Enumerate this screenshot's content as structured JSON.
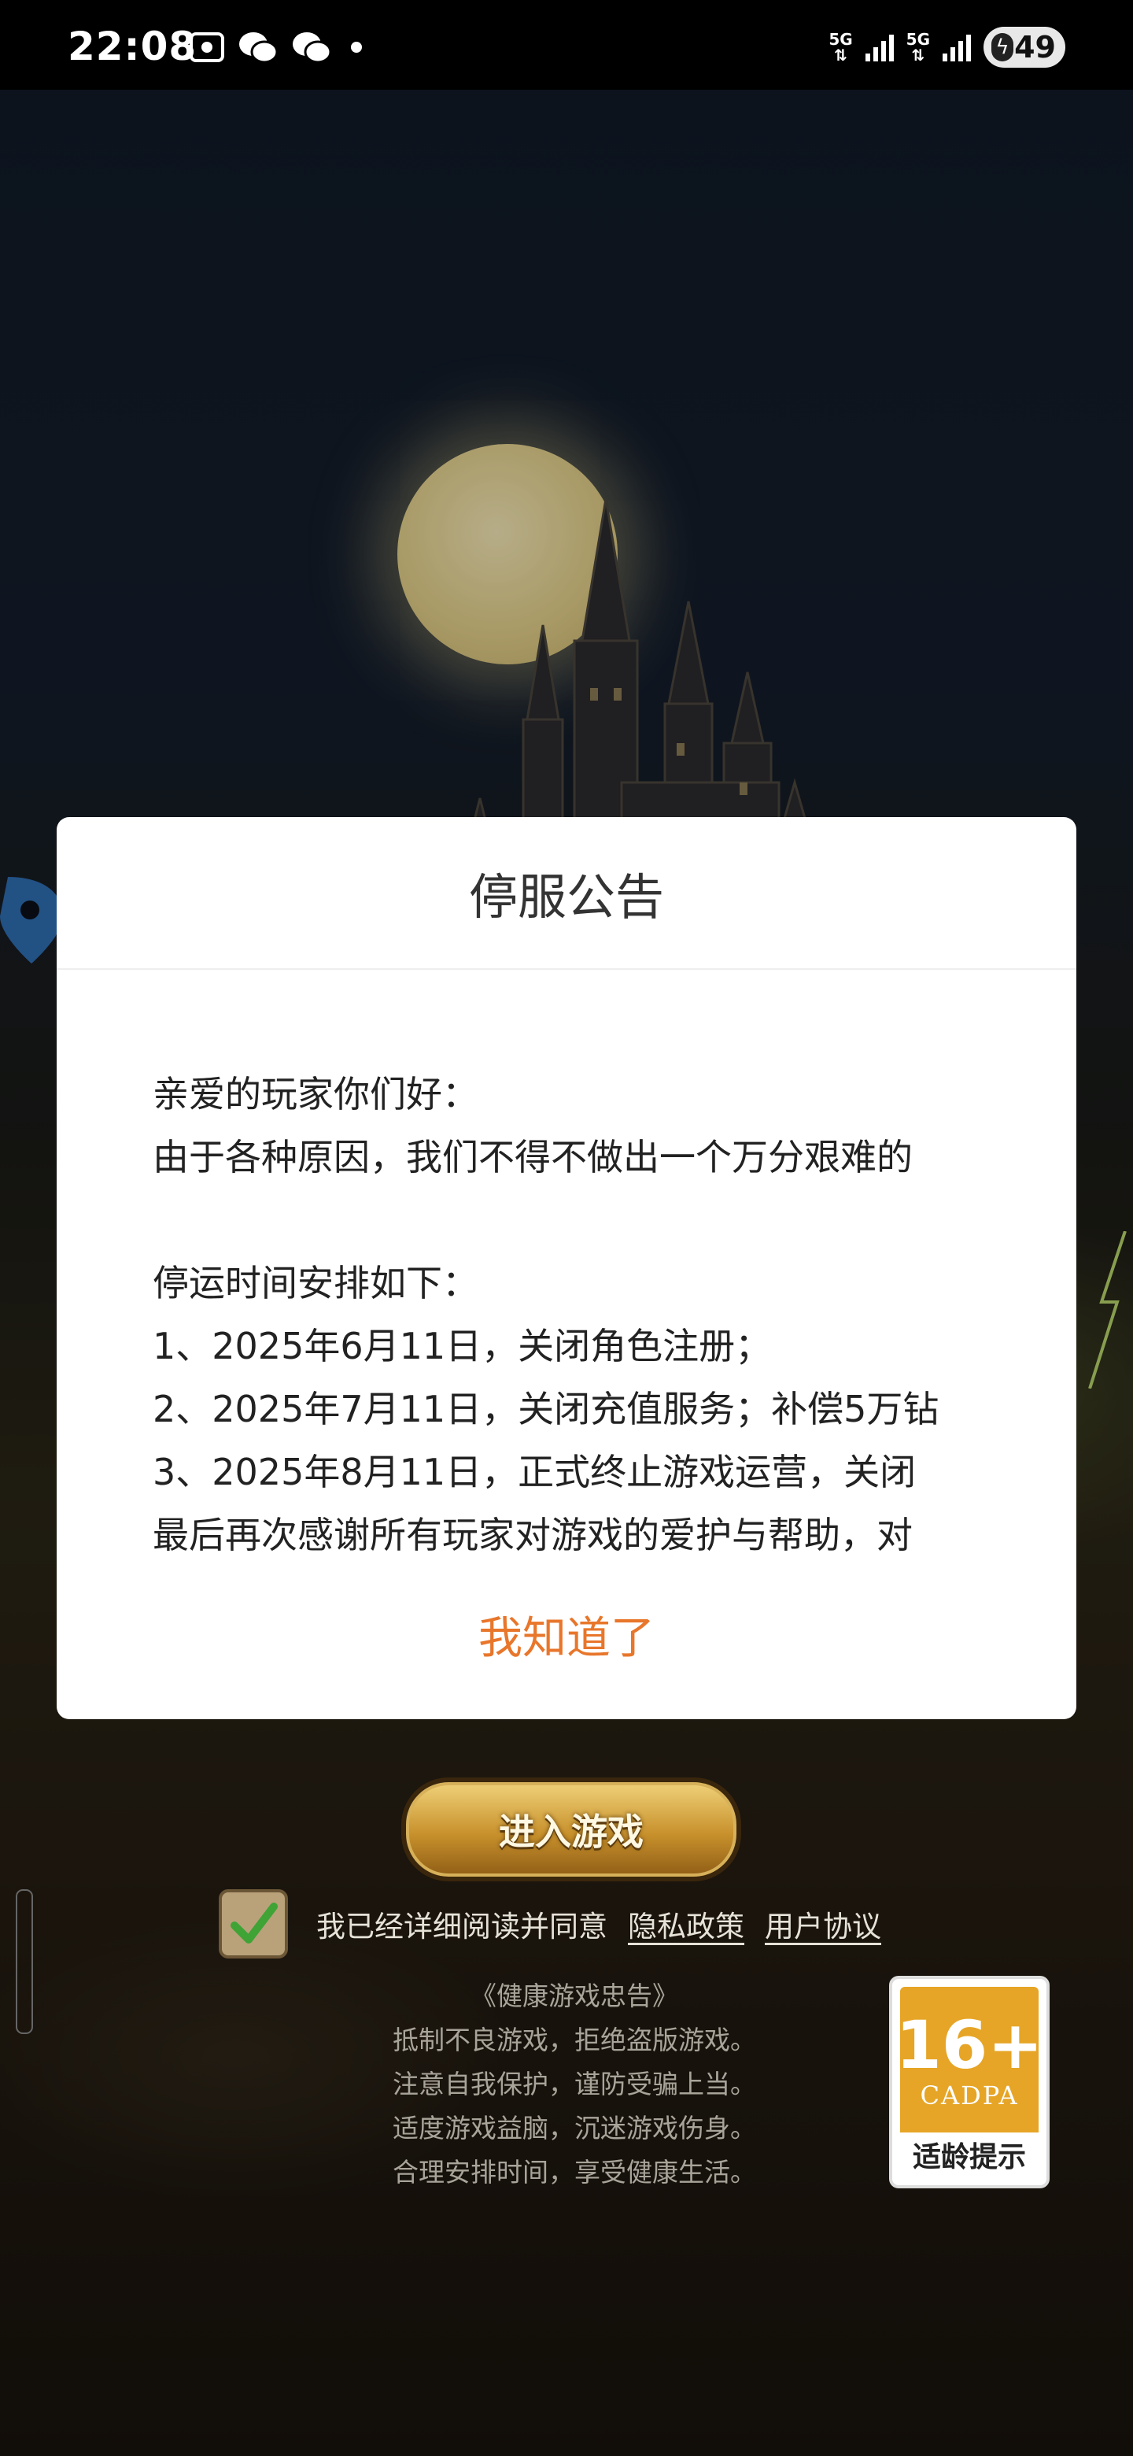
{
  "status_bar": {
    "time": "22:08",
    "network_1": "5G",
    "network_2": "5G",
    "battery": "49",
    "icons": [
      "screenshot-icon",
      "wechat-icon",
      "wechat-icon",
      "dot-icon",
      "signal-icon",
      "signal-icon",
      "battery-charging-icon"
    ]
  },
  "dialog": {
    "title": "停服公告",
    "lines": [
      "亲爱的玩家你们好：",
      "由于各种原因，我们不得不做出一个万分艰难的",
      "",
      "停运时间安排如下：",
      "1、2025年6月11日，关闭角色注册；",
      "2、2025年7月11日，关闭充值服务；补偿5万钻",
      "3、2025年8月11日，正式终止游戏运营，关闭",
      "最后再次感谢所有玩家对游戏的爱护与帮助，对"
    ],
    "confirm_label": "我知道了"
  },
  "game": {
    "enter_label": "进入游戏",
    "agree_text": "我已经详细阅读并同意",
    "privacy_link": "隐私政策",
    "user_agreement_link": "用户协议",
    "checkbox_checked": true,
    "health_advice": {
      "title": "《健康游戏忠告》",
      "lines": [
        "抵制不良游戏，拒绝盗版游戏。",
        "注意自我保护，谨防受骗上当。",
        "适度游戏益脑，沉迷游戏伤身。",
        "合理安排时间，享受健康生活。"
      ]
    },
    "age_rating": {
      "number": "16+",
      "org": "CADPA",
      "label": "适龄提示"
    }
  },
  "colors": {
    "accent": "#e8762b",
    "dialog_bg": "#ffffff",
    "status_bar_bg": "#000000"
  }
}
